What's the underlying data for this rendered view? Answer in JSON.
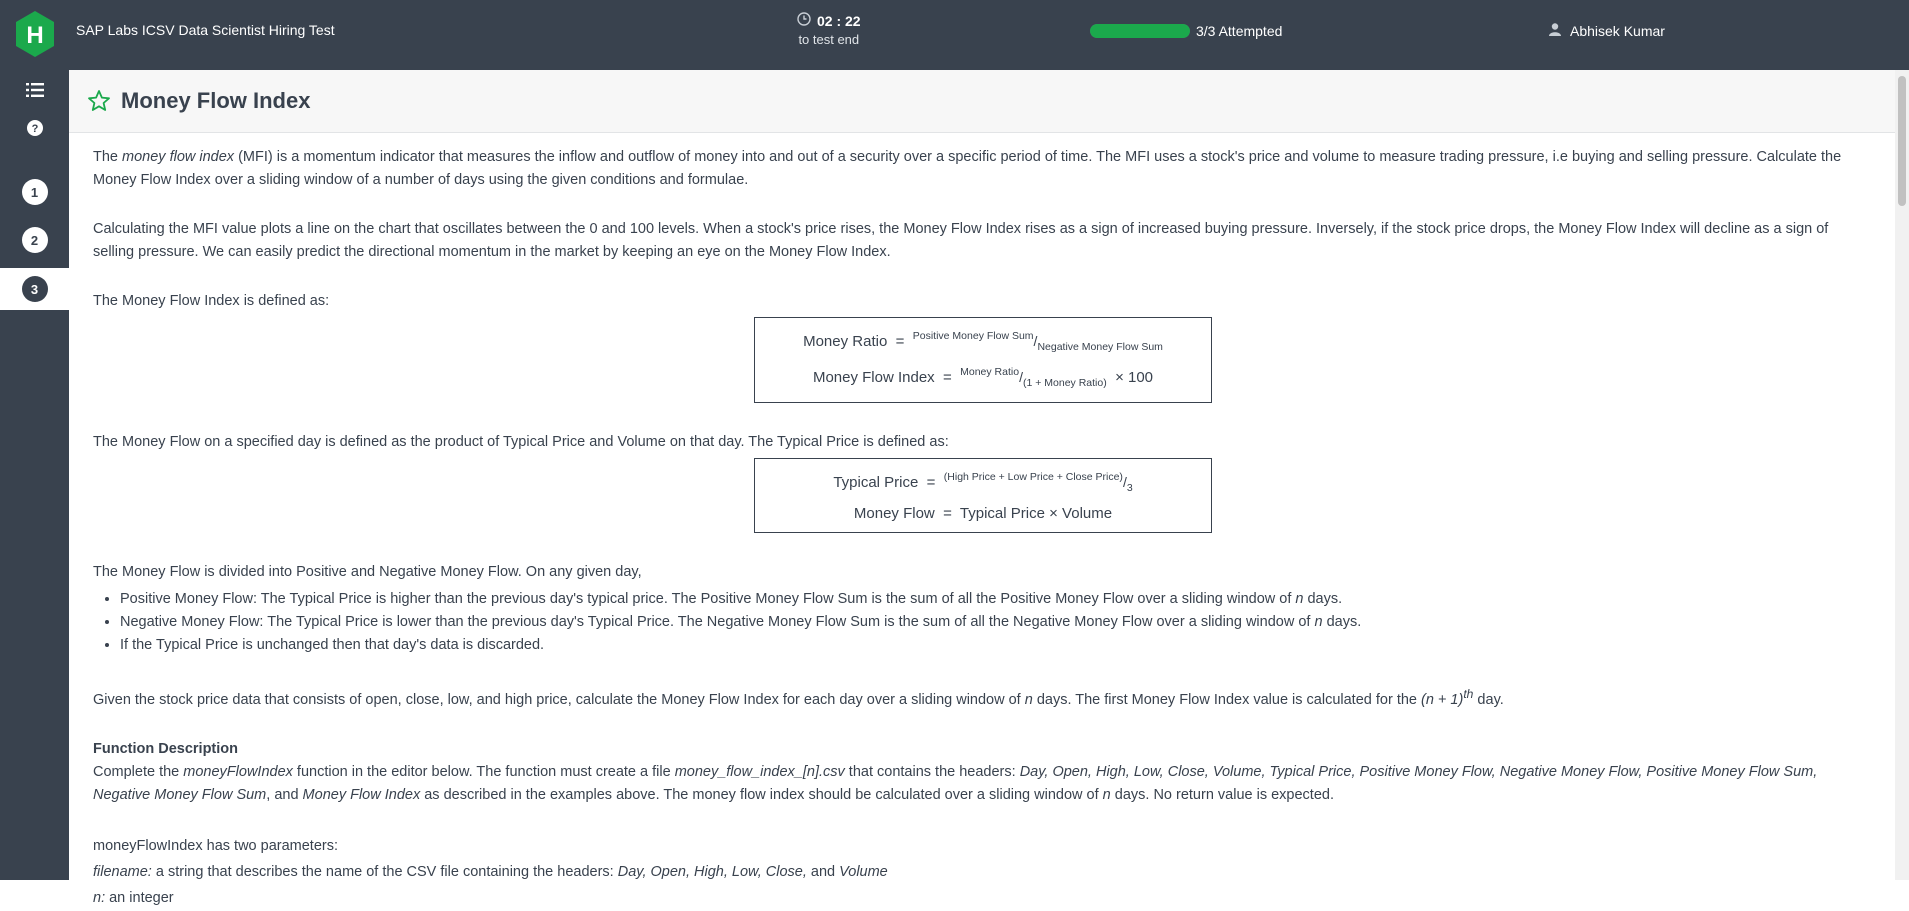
{
  "topbar": {
    "test_title": "SAP Labs ICSV Data Scientist Hiring Test",
    "timer_value": "02 : 22",
    "timer_label": "to test end",
    "progress_fraction": 1.0,
    "progress_label": "3/3 Attempted",
    "user_name": "Abhisek Kumar"
  },
  "sidebar": {
    "questions": [
      "1",
      "2",
      "3"
    ],
    "active_question": "3"
  },
  "question": {
    "title": "Money Flow Index",
    "intro_1_pre": "The ",
    "intro_1_em": "money flow index",
    "intro_1_post": " (MFI) is a momentum indicator that measures the inflow and outflow of money into and out of a security over a specific period of time. The MFI uses a stock's price and volume to measure trading pressure, i.e buying and selling pressure. Calculate the Money Flow Index over a sliding window of a number of days using the given conditions and formulae.",
    "intro_2": "Calculating the MFI value plots a line on the chart that oscillates between the 0 and 100 levels. When a stock's price rises, the Money Flow Index rises as a sign of increased buying pressure. Inversely, if the stock price drops, the Money Flow Index will decline as a sign of selling pressure. We can easily predict the directional momentum in the market by keeping an eye on the Money Flow Index.",
    "defined_as": "The Money Flow Index is defined as:",
    "formula1": {
      "ratio_lhs": "Money Ratio",
      "ratio_num": "Positive Money Flow Sum",
      "ratio_den": "Negative Money Flow Sum",
      "mfi_lhs": "Money Flow Index",
      "mfi_num": "Money Ratio",
      "mfi_den": "(1 + Money Ratio)",
      "mfi_tail": "× 100"
    },
    "money_flow_def": "The Money Flow on a specified day is defined as the product of Typical Price and Volume on that day. The Typical Price is defined as:",
    "formula2": {
      "tp_lhs": "Typical Price",
      "tp_num": "(High Price + Low Price + Close Price)",
      "tp_den": "3",
      "mf_line": "Money Flow  =  Typical Price × Volume"
    },
    "divided": "The Money Flow is divided into Positive and Negative Money Flow. On any given day,",
    "bullets": [
      {
        "pre": "Positive Money Flow:  The Typical Price is higher than the previous day's typical price. The Positive Money Flow Sum is the sum of all the Positive Money Flow over a sliding window of ",
        "em": "n",
        "post": " days."
      },
      {
        "pre": "Negative Money Flow:  The Typical Price is lower than the previous day's Typical Price. The Negative Money Flow Sum is the sum of all the Negative Money Flow over a sliding window of ",
        "em": "n",
        "post": " days."
      },
      {
        "pre": "If the Typical Price is unchanged then that day's data is discarded.",
        "em": "",
        "post": ""
      }
    ],
    "given_pre": "Given the stock price data that consists of open, close, low, and high price, calculate the Money Flow Index for each day over a sliding window of ",
    "given_em": "n",
    "given_mid": " days. The first Money Flow Index value is calculated for the ",
    "given_em2": "(n + 1)",
    "given_sup": "th",
    "given_post": " day.",
    "func_heading": "Function Description",
    "func_1": "Complete the ",
    "func_2": "moneyFlowIndex",
    "func_3": " function in the editor below. The function must create a file ",
    "func_4": "money_flow_index_[n].csv",
    "func_5": " that contains the headers: ",
    "func_6": "Day, Open, High, Low, Close, Volume, Typical Price, Positive Money Flow, Negative Money Flow, Positive Money Flow Sum, Negative Money Flow Sum",
    "func_7": ", and ",
    "func_8": "Money Flow Index",
    "func_9": " as described in the examples above. The money flow index should be calculated over a sliding window of ",
    "func_10": "n",
    "func_11": " days. No return value is expected.",
    "params_heading": "moneyFlowIndex has two parameters:",
    "param1_name": "filename:",
    "param1_desc": " a string that describes the name of the CSV file containing the headers: ",
    "param1_headers": "Day, Open, High, Low, Close,",
    "param1_and": " and ",
    "param1_last": "Volume",
    "param2_name": "n:",
    "param2_desc": " an integer"
  },
  "colors": {
    "topbar": "#39424e",
    "accent_green": "#1ba94c",
    "text": "#39424e"
  }
}
